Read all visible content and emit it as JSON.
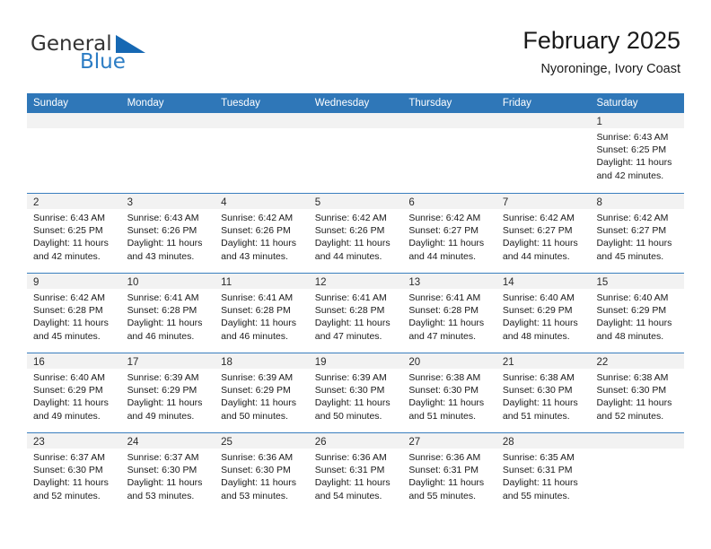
{
  "brand": {
    "name_part1": "General",
    "name_part2": "Blue",
    "triangle_color": "#1668b3",
    "blue_text_color": "#2b7cc4"
  },
  "header": {
    "title": "February 2025",
    "subtitle": "Nyoroninge, Ivory Coast"
  },
  "theme": {
    "header_row_bg": "#2f77b8",
    "header_row_text": "#ffffff",
    "row_divider": "#3a7fbf",
    "daynum_strip_bg": "#f2f2f2"
  },
  "weekdays": [
    "Sunday",
    "Monday",
    "Tuesday",
    "Wednesday",
    "Thursday",
    "Friday",
    "Saturday"
  ],
  "weeks": [
    [
      {
        "day": "",
        "lines": []
      },
      {
        "day": "",
        "lines": []
      },
      {
        "day": "",
        "lines": []
      },
      {
        "day": "",
        "lines": []
      },
      {
        "day": "",
        "lines": []
      },
      {
        "day": "",
        "lines": []
      },
      {
        "day": "1",
        "lines": [
          "Sunrise: 6:43 AM",
          "Sunset: 6:25 PM",
          "Daylight: 11 hours",
          "and 42 minutes."
        ]
      }
    ],
    [
      {
        "day": "2",
        "lines": [
          "Sunrise: 6:43 AM",
          "Sunset: 6:25 PM",
          "Daylight: 11 hours",
          "and 42 minutes."
        ]
      },
      {
        "day": "3",
        "lines": [
          "Sunrise: 6:43 AM",
          "Sunset: 6:26 PM",
          "Daylight: 11 hours",
          "and 43 minutes."
        ]
      },
      {
        "day": "4",
        "lines": [
          "Sunrise: 6:42 AM",
          "Sunset: 6:26 PM",
          "Daylight: 11 hours",
          "and 43 minutes."
        ]
      },
      {
        "day": "5",
        "lines": [
          "Sunrise: 6:42 AM",
          "Sunset: 6:26 PM",
          "Daylight: 11 hours",
          "and 44 minutes."
        ]
      },
      {
        "day": "6",
        "lines": [
          "Sunrise: 6:42 AM",
          "Sunset: 6:27 PM",
          "Daylight: 11 hours",
          "and 44 minutes."
        ]
      },
      {
        "day": "7",
        "lines": [
          "Sunrise: 6:42 AM",
          "Sunset: 6:27 PM",
          "Daylight: 11 hours",
          "and 44 minutes."
        ]
      },
      {
        "day": "8",
        "lines": [
          "Sunrise: 6:42 AM",
          "Sunset: 6:27 PM",
          "Daylight: 11 hours",
          "and 45 minutes."
        ]
      }
    ],
    [
      {
        "day": "9",
        "lines": [
          "Sunrise: 6:42 AM",
          "Sunset: 6:28 PM",
          "Daylight: 11 hours",
          "and 45 minutes."
        ]
      },
      {
        "day": "10",
        "lines": [
          "Sunrise: 6:41 AM",
          "Sunset: 6:28 PM",
          "Daylight: 11 hours",
          "and 46 minutes."
        ]
      },
      {
        "day": "11",
        "lines": [
          "Sunrise: 6:41 AM",
          "Sunset: 6:28 PM",
          "Daylight: 11 hours",
          "and 46 minutes."
        ]
      },
      {
        "day": "12",
        "lines": [
          "Sunrise: 6:41 AM",
          "Sunset: 6:28 PM",
          "Daylight: 11 hours",
          "and 47 minutes."
        ]
      },
      {
        "day": "13",
        "lines": [
          "Sunrise: 6:41 AM",
          "Sunset: 6:28 PM",
          "Daylight: 11 hours",
          "and 47 minutes."
        ]
      },
      {
        "day": "14",
        "lines": [
          "Sunrise: 6:40 AM",
          "Sunset: 6:29 PM",
          "Daylight: 11 hours",
          "and 48 minutes."
        ]
      },
      {
        "day": "15",
        "lines": [
          "Sunrise: 6:40 AM",
          "Sunset: 6:29 PM",
          "Daylight: 11 hours",
          "and 48 minutes."
        ]
      }
    ],
    [
      {
        "day": "16",
        "lines": [
          "Sunrise: 6:40 AM",
          "Sunset: 6:29 PM",
          "Daylight: 11 hours",
          "and 49 minutes."
        ]
      },
      {
        "day": "17",
        "lines": [
          "Sunrise: 6:39 AM",
          "Sunset: 6:29 PM",
          "Daylight: 11 hours",
          "and 49 minutes."
        ]
      },
      {
        "day": "18",
        "lines": [
          "Sunrise: 6:39 AM",
          "Sunset: 6:29 PM",
          "Daylight: 11 hours",
          "and 50 minutes."
        ]
      },
      {
        "day": "19",
        "lines": [
          "Sunrise: 6:39 AM",
          "Sunset: 6:30 PM",
          "Daylight: 11 hours",
          "and 50 minutes."
        ]
      },
      {
        "day": "20",
        "lines": [
          "Sunrise: 6:38 AM",
          "Sunset: 6:30 PM",
          "Daylight: 11 hours",
          "and 51 minutes."
        ]
      },
      {
        "day": "21",
        "lines": [
          "Sunrise: 6:38 AM",
          "Sunset: 6:30 PM",
          "Daylight: 11 hours",
          "and 51 minutes."
        ]
      },
      {
        "day": "22",
        "lines": [
          "Sunrise: 6:38 AM",
          "Sunset: 6:30 PM",
          "Daylight: 11 hours",
          "and 52 minutes."
        ]
      }
    ],
    [
      {
        "day": "23",
        "lines": [
          "Sunrise: 6:37 AM",
          "Sunset: 6:30 PM",
          "Daylight: 11 hours",
          "and 52 minutes."
        ]
      },
      {
        "day": "24",
        "lines": [
          "Sunrise: 6:37 AM",
          "Sunset: 6:30 PM",
          "Daylight: 11 hours",
          "and 53 minutes."
        ]
      },
      {
        "day": "25",
        "lines": [
          "Sunrise: 6:36 AM",
          "Sunset: 6:30 PM",
          "Daylight: 11 hours",
          "and 53 minutes."
        ]
      },
      {
        "day": "26",
        "lines": [
          "Sunrise: 6:36 AM",
          "Sunset: 6:31 PM",
          "Daylight: 11 hours",
          "and 54 minutes."
        ]
      },
      {
        "day": "27",
        "lines": [
          "Sunrise: 6:36 AM",
          "Sunset: 6:31 PM",
          "Daylight: 11 hours",
          "and 55 minutes."
        ]
      },
      {
        "day": "28",
        "lines": [
          "Sunrise: 6:35 AM",
          "Sunset: 6:31 PM",
          "Daylight: 11 hours",
          "and 55 minutes."
        ]
      },
      {
        "day": "",
        "lines": []
      }
    ]
  ]
}
